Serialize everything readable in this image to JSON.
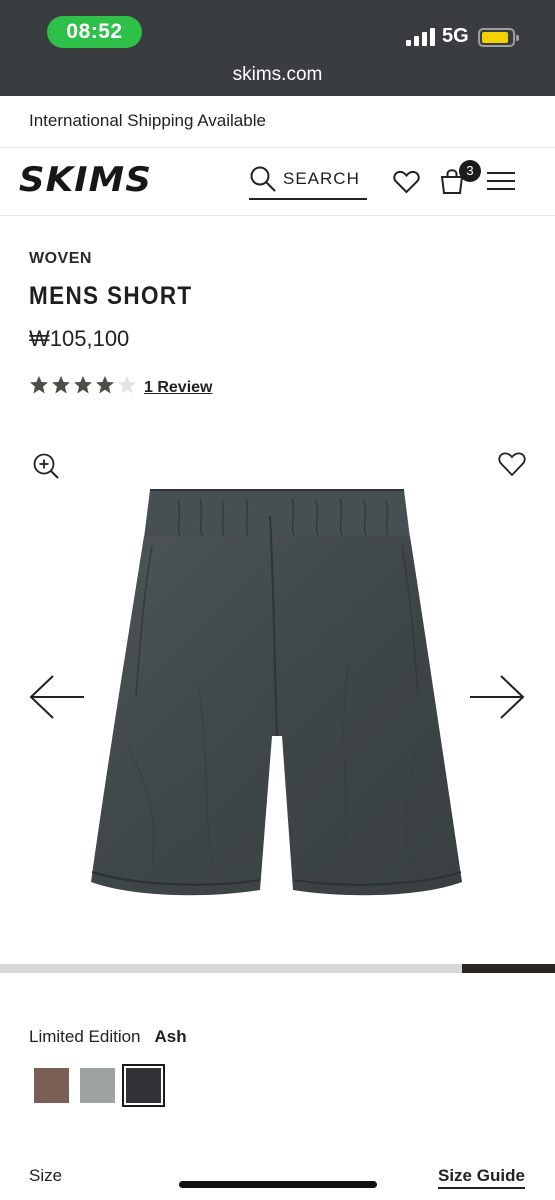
{
  "status_bar": {
    "time": "08:52",
    "network": "5G",
    "battery_color": "#f2d100",
    "time_pill_color": "#2fc04a"
  },
  "browser": {
    "url": "skims.com"
  },
  "announcement": {
    "text": "International Shipping Available"
  },
  "header": {
    "logo": "SKIMS",
    "search_label": "SEARCH",
    "cart_count": "3",
    "icons": [
      "search-icon",
      "heart-icon",
      "bag-icon",
      "menu-icon"
    ]
  },
  "product": {
    "category": "WOVEN",
    "title": "MENS SHORT",
    "price": "₩105,100",
    "rating": 4,
    "rating_max": 5,
    "review_link": "1 Review",
    "image_icons": [
      "zoom-in-icon",
      "heart-icon",
      "arrow-left-icon",
      "arrow-right-icon"
    ],
    "gallery_progress": {
      "start": 0.833,
      "end": 1.0
    }
  },
  "color_selector": {
    "label": "Limited Edition",
    "selected": "Ash",
    "swatches": [
      {
        "color": "#7a5f57",
        "selected": false
      },
      {
        "color": "#9ea2a2",
        "selected": false
      },
      {
        "color": "#303238",
        "selected": true
      }
    ]
  },
  "size": {
    "label": "Size",
    "guide_link": "Size Guide"
  },
  "colors": {
    "topbar": "#3a3d3f",
    "short_fabric": "#434a4c",
    "accent": "#1c1c1c"
  }
}
